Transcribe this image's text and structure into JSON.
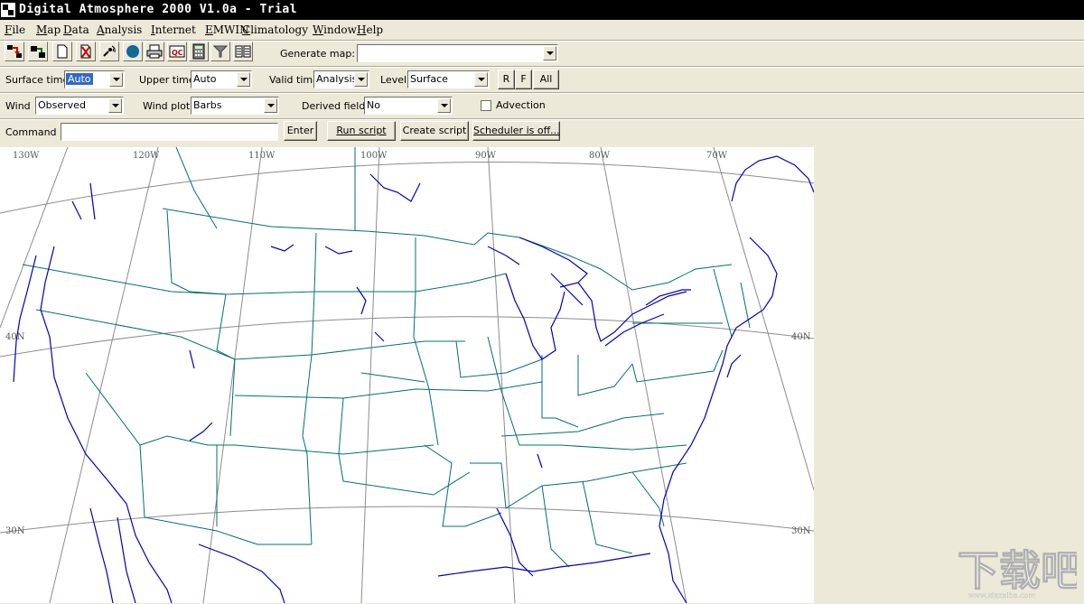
{
  "window": {
    "title": "Digital Atmosphere 2000 V1.0a - Trial"
  },
  "menu": [
    {
      "pre": "",
      "u": "F",
      "post": "ile"
    },
    {
      "pre": "",
      "u": "M",
      "post": "ap"
    },
    {
      "pre": "",
      "u": "D",
      "post": "ata"
    },
    {
      "pre": "",
      "u": "A",
      "post": "nalysis"
    },
    {
      "pre": "",
      "u": "I",
      "post": "nternet"
    },
    {
      "pre": "",
      "u": "E",
      "post": "MWIN"
    },
    {
      "pre": "",
      "u": "C",
      "post": "limatology"
    },
    {
      "pre": "",
      "u": "W",
      "post": "indow"
    },
    {
      "pre": "",
      "u": "H",
      "post": "elp"
    }
  ],
  "toolbar": {
    "icons": [
      "import-data-icon",
      "download-icon",
      "new-document-icon",
      "delete-icon",
      "satellite-icon",
      "globe-icon",
      "print-icon",
      "qc-icon",
      "calculator-icon",
      "filter-icon",
      "list-icon"
    ],
    "generate_map_label": "Generate map:",
    "generate_map_value": ""
  },
  "row1": {
    "surface_time_label": "Surface time",
    "surface_time_value": "Auto",
    "upper_time_label": "Upper time",
    "upper_time_value": "Auto",
    "valid_time_label": "Valid time",
    "valid_time_value": "Analysis",
    "level_label": "Level",
    "level_value": "Surface",
    "r_label": "R",
    "f_label": "F",
    "all_label": "All"
  },
  "row2": {
    "wind_label": "Wind",
    "wind_value": "Observed",
    "wind_plot_label": "Wind plot",
    "wind_plot_value": "Barbs",
    "derived_field_label": "Derived field",
    "derived_field_value": "No",
    "advection_label": "Advection"
  },
  "row3": {
    "command_label": "Command",
    "command_value": "",
    "enter_label": "Enter",
    "run_script_label": "Run script",
    "create_script_label": "Create script",
    "scheduler_label": "Scheduler is off..."
  },
  "map": {
    "longitude_labels": [
      "130W",
      "120W",
      "110W",
      "100W",
      "90W",
      "80W",
      "70W"
    ],
    "latitude_labels_left": [
      "40N",
      "30N"
    ],
    "latitude_labels_right": [
      "40N",
      "30N"
    ],
    "colors": {
      "coast": "#0000c0",
      "border": "#007070",
      "grid": "#888888"
    }
  },
  "watermark": {
    "text": "下载吧",
    "url": "www.xiazaiba.com"
  }
}
